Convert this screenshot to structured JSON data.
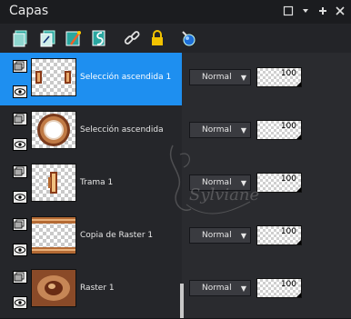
{
  "panel": {
    "title": "Capas",
    "window_buttons": [
      "restore-icon",
      "pin-icon",
      "menu-icon",
      "close-icon"
    ]
  },
  "toolbar": {
    "icons": [
      "new-raster-layer-icon",
      "new-vector-layer-icon",
      "new-mask-layer-icon",
      "new-adjustment-layer-icon",
      "link-icon",
      "lock-icon",
      "eyedropper-icon"
    ]
  },
  "layers": [
    {
      "name": "Selección ascendida 1",
      "blend_mode": "Normal",
      "opacity": "100",
      "selected": true
    },
    {
      "name": "Selección ascendida",
      "blend_mode": "Normal",
      "opacity": "100",
      "selected": false
    },
    {
      "name": "Trama 1",
      "blend_mode": "Normal",
      "opacity": "100",
      "selected": false
    },
    {
      "name": "Copia de Raster 1",
      "blend_mode": "Normal",
      "opacity": "100",
      "selected": false
    },
    {
      "name": "Raster 1",
      "blend_mode": "Normal",
      "opacity": "100",
      "selected": false
    }
  ],
  "watermark": {
    "text": "Sylviane"
  },
  "colors": {
    "selection": "#1e8ff0",
    "background": "#232428"
  }
}
